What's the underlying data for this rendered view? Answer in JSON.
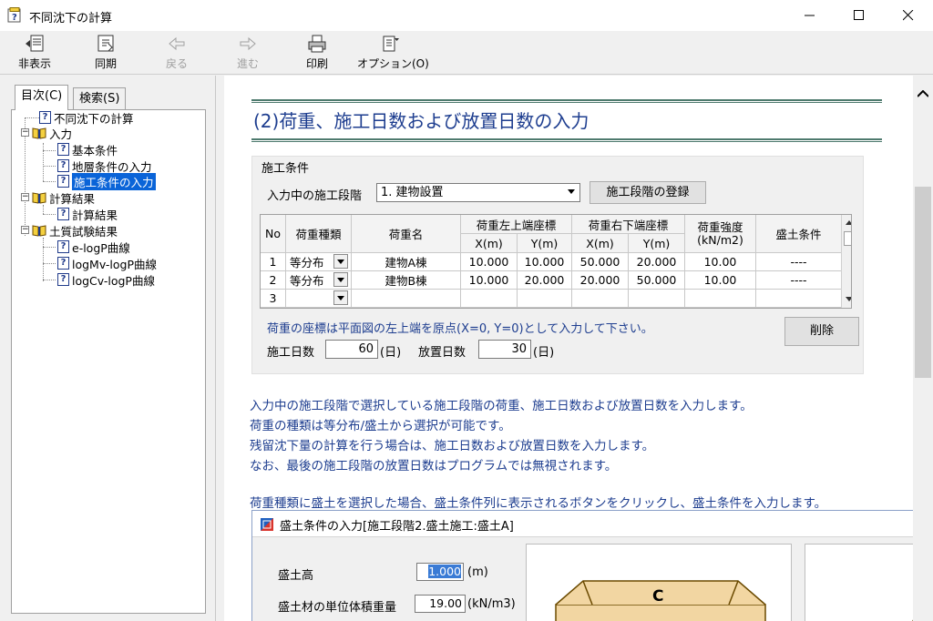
{
  "window": {
    "title": "不同沈下の計算"
  },
  "toolbar": {
    "hide": "非表示",
    "sync": "同期",
    "back": "戻る",
    "forward": "進む",
    "print": "印刷",
    "options": "オプション(O)"
  },
  "left": {
    "tabs": {
      "contents": "目次(C)",
      "search": "検索(S)"
    },
    "tree": {
      "root": "不同沈下の計算",
      "input": "入力",
      "input_basic": "基本条件",
      "input_ground": "地層条件の入力",
      "input_construction": "施工条件の入力",
      "result": "計算結果",
      "result_item": "計算結果",
      "soil": "土質試験結果",
      "soil_elogp": "e-logP曲線",
      "soil_logmv": "logMv-logP曲線",
      "soil_logcv": "logCv-logP曲線"
    }
  },
  "doc": {
    "heading": "(2)荷重、施工日数および放置日数の入力",
    "group_label": "施工条件",
    "stage_label": "入力中の施工段階",
    "stage_value": "1. 建物設置",
    "register_button": "施工段階の登録",
    "grid": {
      "headers": {
        "no": "No",
        "type": "荷重種類",
        "name": "荷重名",
        "top_left": "荷重左上端座標",
        "bottom_right": "荷重右下端座標",
        "x": "X(m)",
        "y": "Y(m)",
        "intensity": "荷重強度",
        "intensity_unit": "(kN/m2)",
        "fill": "盛土条件"
      },
      "rows": [
        {
          "no": "1",
          "type": "等分布",
          "name": "建物A棟",
          "x1": "10.000",
          "y1": "10.000",
          "x2": "50.000",
          "y2": "20.000",
          "q": "10.00",
          "fill": "----"
        },
        {
          "no": "2",
          "type": "等分布",
          "name": "建物B棟",
          "x1": "10.000",
          "y1": "20.000",
          "x2": "20.000",
          "y2": "50.000",
          "q": "10.00",
          "fill": "----"
        },
        {
          "no": "3",
          "type": "",
          "name": "",
          "x1": "",
          "y1": "",
          "x2": "",
          "y2": "",
          "q": "",
          "fill": ""
        }
      ]
    },
    "note": "荷重の座標は平面図の左上端を原点(X=0, Y=0)として入力して下さい。",
    "delete_button": "削除",
    "construction_days_label": "施工日数",
    "construction_days": "60",
    "leave_days_label": "放置日数",
    "leave_days": "30",
    "days_unit": "(日)",
    "paragraphs": [
      "入力中の施工段階で選択している施工段階の荷重、施工日数および放置日数を入力します。",
      "荷重の種類は等分布/盛土から選択が可能です。",
      "残留沈下量の計算を行う場合は、施工日数および放置日数を入力します。",
      "なお、最後の施工段階の放置日数はプログラムでは無視されます。",
      "荷重種類に盛土を選択した場合、盛土条件列に表示されるボタンをクリックし、盛土条件を入力します。"
    ],
    "dialog": {
      "title": "盛土条件の入力[施工段階2.盛土施工:盛土A]",
      "height_label": "盛土高",
      "height_value": "1.000",
      "height_unit": "(m)",
      "unit_weight_label": "盛土材の単位体積重量",
      "unit_weight_value": "19.00",
      "unit_weight_unit": "(kN/m3)",
      "preview_label": "C"
    }
  }
}
